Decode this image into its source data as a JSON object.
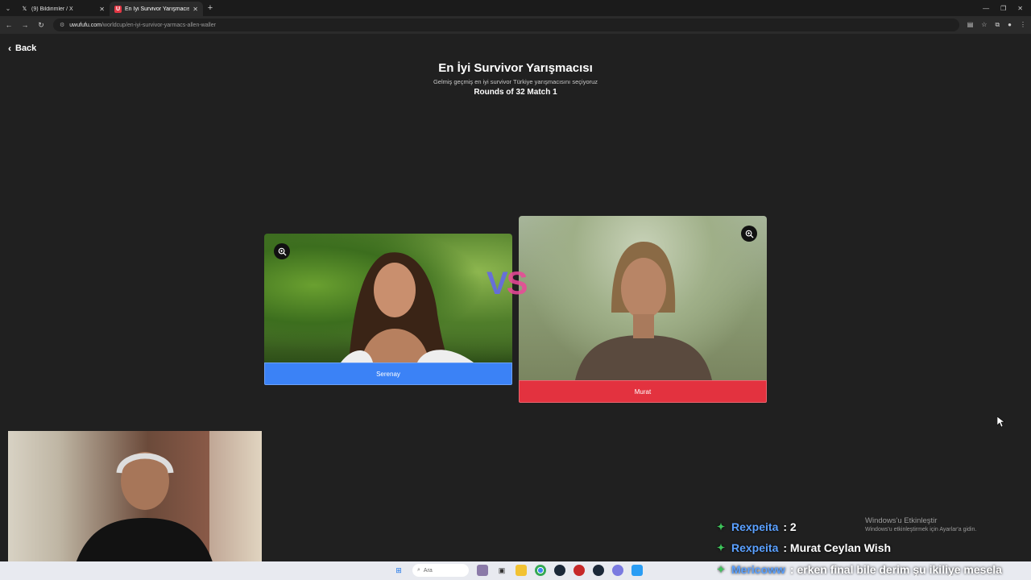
{
  "browser": {
    "tabs": [
      {
        "title": "(9) Bildirimler / X",
        "favicon": "x-logo-icon",
        "active": false
      },
      {
        "title": "En İyi Survivor Yarışmacısı | Uwufufu",
        "favicon": "uwufufu-logo-icon",
        "active": true
      }
    ],
    "url_host": "uwufufu.com",
    "url_path": "/worldcup/en-iyi-survivor-yarmacs-allen-waller"
  },
  "page": {
    "back_label": "Back",
    "title": "En İyi Survivor Yarışmacısı",
    "subtitle": "Gelmiş geçmiş en iyi survivor Türkiye yarışmacısını seçiyoruz",
    "round_label": "Rounds of 32 Match 1",
    "vs_v": "V",
    "vs_s": "S",
    "left": {
      "name": "Serenay",
      "color": "#3b82f6"
    },
    "right": {
      "name": "Murat",
      "color": "#e3323f"
    }
  },
  "chat": [
    {
      "user": "Rexpeita",
      "message": ": 2"
    },
    {
      "user": "Rexpeita",
      "message": ": Murat Ceylan Wish"
    },
    {
      "user": "Mericoww",
      "message": ": erken final bile derim şu ikiliye mesela"
    }
  ],
  "windows_activation": {
    "title": "Windows'u Etkinleştir",
    "detail": "Windows'u etkinleştirmek için Ayarlar'a gidin."
  },
  "taskbar": {
    "search_placeholder": "Ara"
  }
}
